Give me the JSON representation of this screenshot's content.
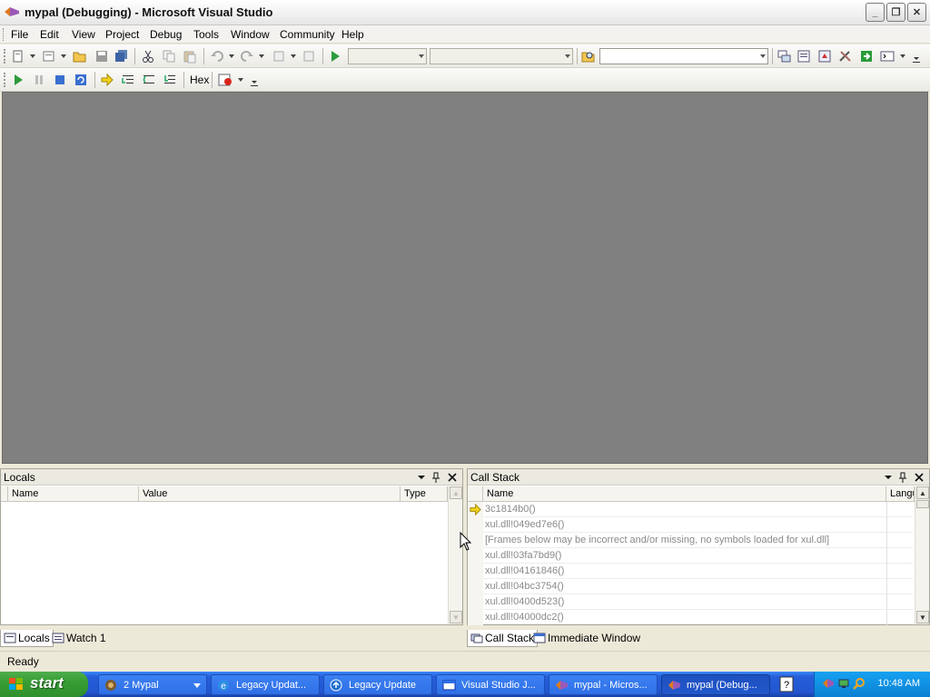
{
  "window": {
    "title": "mypal (Debugging) - Microsoft Visual Studio",
    "min_glyph": "_",
    "restore_glyph": "❐",
    "close_glyph": "✕"
  },
  "menu": [
    "File",
    "Edit",
    "View",
    "Project",
    "Debug",
    "Tools",
    "Window",
    "Community",
    "Help"
  ],
  "debug_toolbar": {
    "hex_label": "Hex"
  },
  "locals_panel": {
    "title": "Locals",
    "columns": [
      "Name",
      "Value",
      "Type"
    ]
  },
  "callstack_panel": {
    "title": "Call Stack",
    "columns": [
      "Name",
      "Langu"
    ],
    "frames": [
      "3c1814b0()",
      "xul.dll!049ed7e6()",
      "[Frames below may be incorrect and/or missing, no symbols loaded for xul.dll]",
      "xul.dll!03fa7bd9()",
      "xul.dll!04161846()",
      "xul.dll!04bc3754()",
      "xul.dll!0400d523()",
      "xul.dll!04000dc2()"
    ]
  },
  "left_tabs": [
    "Locals",
    "Watch 1"
  ],
  "right_tabs": [
    "Call Stack",
    "Immediate Window"
  ],
  "status": "Ready",
  "taskbar": {
    "start_label": "start",
    "tasks": [
      {
        "label": "2 Mypal",
        "icon": "mypal-icon"
      },
      {
        "label": "Legacy Updat...",
        "icon": "ie-icon"
      },
      {
        "label": "Legacy Update",
        "icon": "legacy-update-icon"
      },
      {
        "label": "Visual Studio J...",
        "icon": "window-icon"
      },
      {
        "label": "mypal - Micros...",
        "icon": "vs-icon"
      },
      {
        "label": "mypal (Debug...",
        "icon": "vs-icon"
      }
    ],
    "clock": "10:48 AM"
  },
  "colors": {
    "editor_bg": "#808080",
    "taskbar_blue": "#245edb",
    "start_green": "#379e34",
    "tray_blue": "#0f8ee0"
  }
}
